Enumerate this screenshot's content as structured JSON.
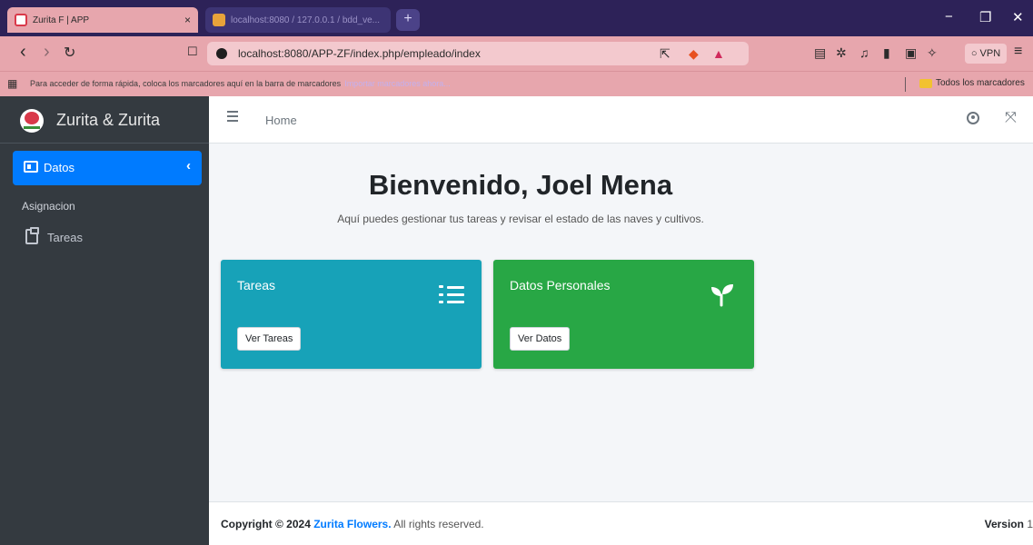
{
  "browser": {
    "tabs": [
      {
        "title": "Zurita F | APP",
        "close": "×"
      },
      {
        "title": "localhost:8080 / 127.0.0.1 / bdd_ve..."
      }
    ],
    "new_tab": "+",
    "window_controls": {
      "minimize": "−",
      "maximize": "❐",
      "close": "✕"
    },
    "nav": {
      "back": "‹",
      "forward": "›",
      "reload": "↻",
      "bookmark": "☐"
    },
    "url": "localhost:8080/APP-ZF/index.php/empleado/index",
    "vpn_label": "VPN",
    "bookmarks_bar": {
      "hint": "Para acceder de forma rápida, coloca los marcadores aquí en la barra de marcadores",
      "import_link": "Importar marcadores ahora...",
      "all_bookmarks": "Todos los marcadores"
    }
  },
  "sidebar": {
    "brand": "Zurita & Zurita",
    "active_item": {
      "label": "Datos",
      "chevron": "‹"
    },
    "header": "Asignacion",
    "items": [
      {
        "label": "Tareas"
      }
    ]
  },
  "topnav": {
    "home": "Home",
    "expand_icon": "⤧"
  },
  "main": {
    "title": "Bienvenido, Joel Mena",
    "subtitle": "Aquí puedes gestionar tus tareas y revisar el estado de las naves y cultivos.",
    "cards": [
      {
        "title": "Tareas",
        "button": "Ver Tareas",
        "color": "#17a2b8",
        "icon": "tasks-list-icon"
      },
      {
        "title": "Datos Personales",
        "button": "Ver Datos",
        "color": "#28a745",
        "icon": "seedling-icon"
      }
    ]
  },
  "footer": {
    "copyright_prefix": "Copyright © 2024",
    "brand": "Zurita Flowers.",
    "rights": "All rights reserved.",
    "version_label": "Version",
    "version_number": "1"
  },
  "colors": {
    "primary": "#007bff",
    "sidebar": "#343a40",
    "browser_tab": "#2d2258",
    "browser_chrome": "#e7a6ad"
  }
}
